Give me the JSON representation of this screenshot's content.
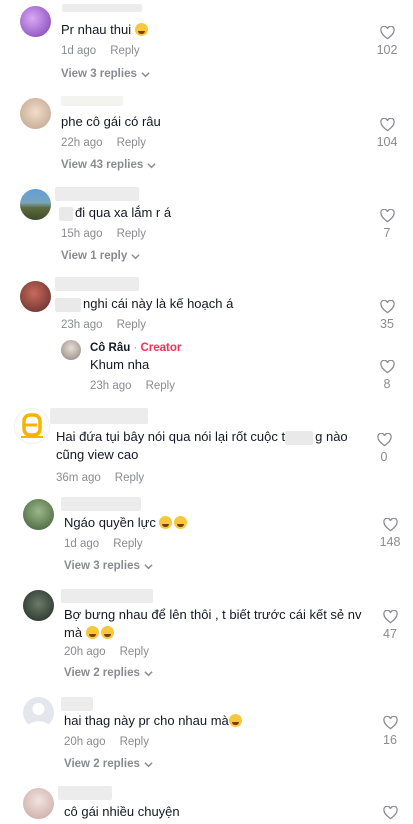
{
  "comments": [
    {
      "text": "Pr nhau thui",
      "emoji": "sweat-smile",
      "time": "1d ago",
      "reply": "Reply",
      "view_replies": "View 3 replies",
      "likes": "102"
    },
    {
      "text": "phe cô gái có râu",
      "time": "22h ago",
      "reply": "Reply",
      "view_replies": "View 43 replies",
      "likes": "104"
    },
    {
      "text": "đi qua xa lắm r á",
      "time": "15h ago",
      "reply": "Reply",
      "view_replies": "View 1 reply",
      "likes": "7"
    },
    {
      "text": "nghi cái này là kế hoạch á",
      "time": "23h ago",
      "reply": "Reply",
      "likes": "35",
      "reply_item": {
        "author": "Cô Râu",
        "separator": " · ",
        "creator_label": "Creator",
        "text": "Khum nha",
        "time": "23h ago",
        "reply": "Reply",
        "likes": "8"
      }
    },
    {
      "text_a": "Hai đứa tụi bây nói qua nói lại rốt cuộc t",
      "text_b": "g nào",
      "text_line2": "cũng view cao",
      "time": "36m ago",
      "reply": "Reply",
      "likes": "0"
    },
    {
      "text": "Ngáo quyền lực",
      "time": "1d ago",
      "reply": "Reply",
      "view_replies": "View 3 replies",
      "likes": "148"
    },
    {
      "text": "Bợ bưng nhau để lên thôi , t biết trước cái kết sẻ nv",
      "text_line2": "mà",
      "time": "20h ago",
      "reply": "Reply",
      "view_replies": "View 2 replies",
      "likes": "47"
    },
    {
      "text": "hai thag này pr cho nhau mà",
      "time": "20h ago",
      "reply": "Reply",
      "view_replies": "View 2 replies",
      "likes": "16"
    },
    {
      "text": "cô gái nhiều chuyện"
    }
  ],
  "colors": {
    "accent": "#fe2c55",
    "muted": "#8a8b91",
    "text": "#161823"
  }
}
